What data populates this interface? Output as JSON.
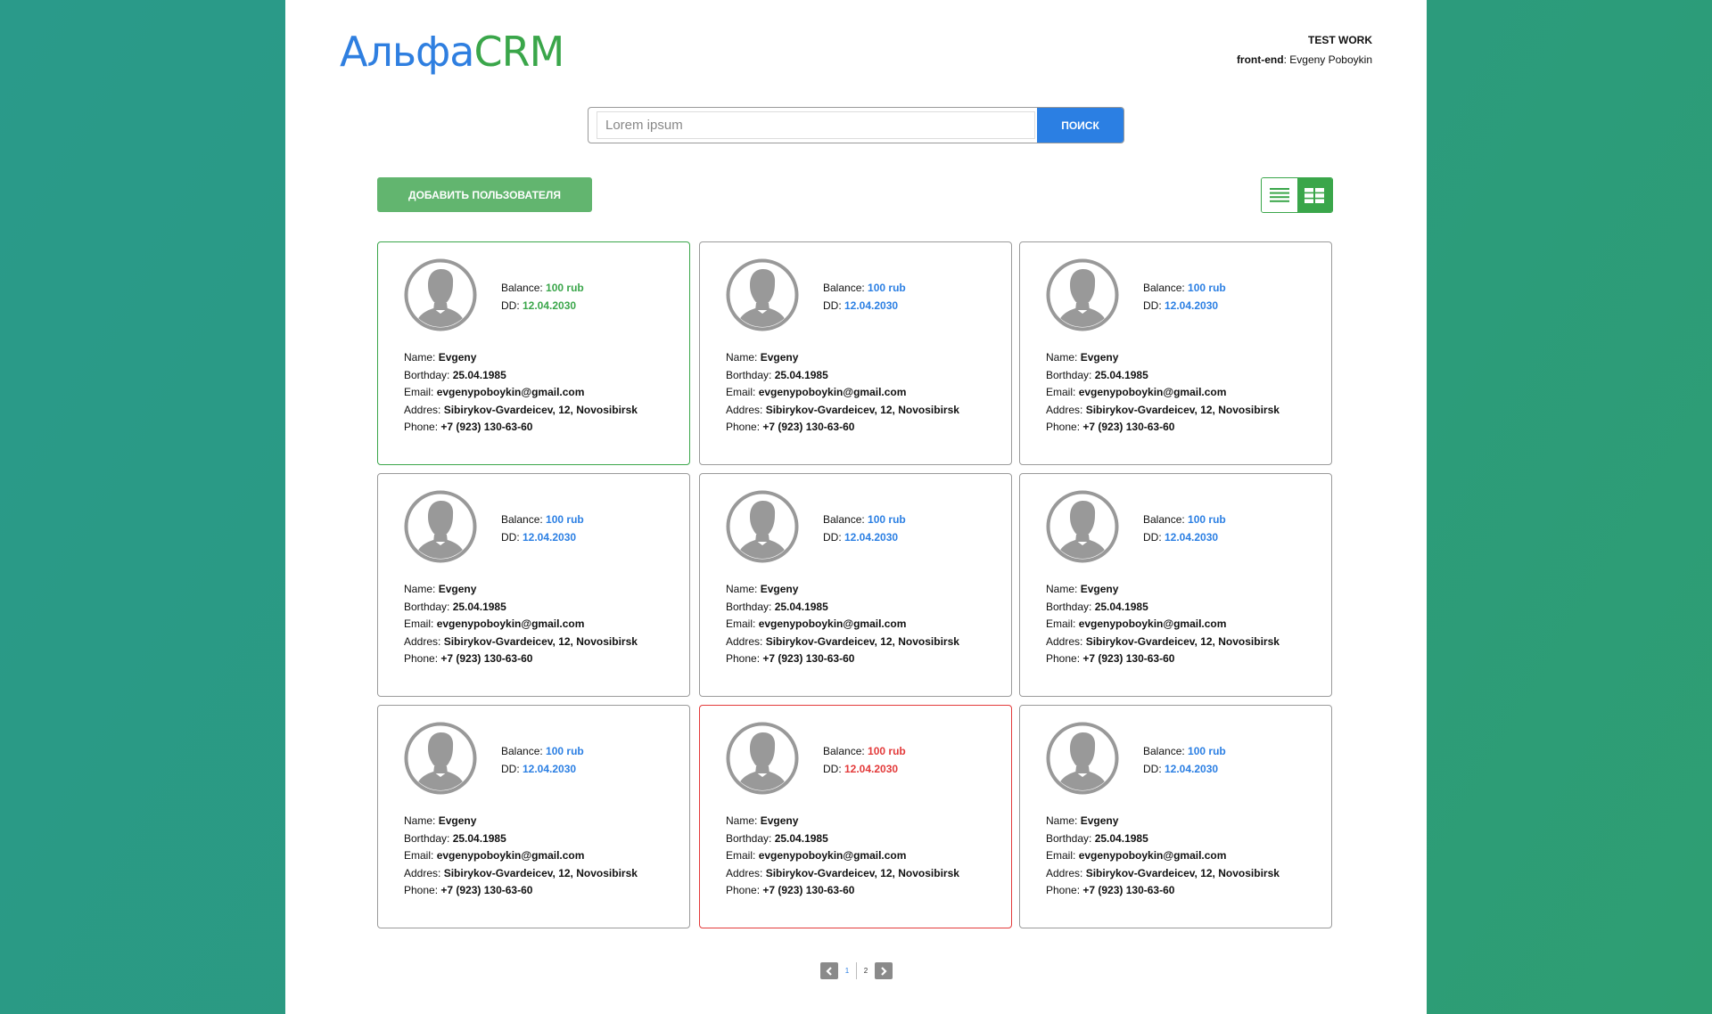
{
  "header": {
    "logo_part1": "Альфа",
    "logo_part2": "CRM",
    "title": "TEST WORK",
    "credit_label": "front-end",
    "credit_sep": ": ",
    "credit_name": "Evgeny Poboykin"
  },
  "search": {
    "placeholder": "Lorem ipsum",
    "button_label": "ПОИСК"
  },
  "toolbar": {
    "add_user_label": "ДОБАВИТЬ ПОЛЬЗОВАТЕЛЯ",
    "active_view": "grid"
  },
  "labels": {
    "balance": "Balance: ",
    "dd": "DD: ",
    "name": "Name: ",
    "birthday": "Borthday: ",
    "email": "Email: ",
    "address": "Addres: ",
    "phone": "Phone: "
  },
  "colors": {
    "brand_blue": "#2b7fe3",
    "brand_green": "#3aa64a",
    "alert_red": "#e33a3a"
  },
  "users": [
    {
      "balance": "100 rub",
      "dd": "12.04.2030",
      "name": "Evgeny",
      "birthday": "25.04.1985",
      "email": "evgenypoboykin@gmail.com",
      "address": "Sibirykov-Gvardeicev, 12, Novosibirsk",
      "phone": "+7 (923) 130-63-60",
      "status": "active"
    },
    {
      "balance": "100 rub",
      "dd": "12.04.2030",
      "name": "Evgeny",
      "birthday": "25.04.1985",
      "email": "evgenypoboykin@gmail.com",
      "address": "Sibirykov-Gvardeicev, 12, Novosibirsk",
      "phone": "+7 (923) 130-63-60",
      "status": "normal"
    },
    {
      "balance": "100 rub",
      "dd": "12.04.2030",
      "name": "Evgeny",
      "birthday": "25.04.1985",
      "email": "evgenypoboykin@gmail.com",
      "address": "Sibirykov-Gvardeicev, 12, Novosibirsk",
      "phone": "+7 (923) 130-63-60",
      "status": "normal"
    },
    {
      "balance": "100 rub",
      "dd": "12.04.2030",
      "name": "Evgeny",
      "birthday": "25.04.1985",
      "email": "evgenypoboykin@gmail.com",
      "address": "Sibirykov-Gvardeicev, 12, Novosibirsk",
      "phone": "+7 (923) 130-63-60",
      "status": "normal"
    },
    {
      "balance": "100 rub",
      "dd": "12.04.2030",
      "name": "Evgeny",
      "birthday": "25.04.1985",
      "email": "evgenypoboykin@gmail.com",
      "address": "Sibirykov-Gvardeicev, 12, Novosibirsk",
      "phone": "+7 (923) 130-63-60",
      "status": "normal"
    },
    {
      "balance": "100 rub",
      "dd": "12.04.2030",
      "name": "Evgeny",
      "birthday": "25.04.1985",
      "email": "evgenypoboykin@gmail.com",
      "address": "Sibirykov-Gvardeicev, 12, Novosibirsk",
      "phone": "+7 (923) 130-63-60",
      "status": "normal"
    },
    {
      "balance": "100 rub",
      "dd": "12.04.2030",
      "name": "Evgeny",
      "birthday": "25.04.1985",
      "email": "evgenypoboykin@gmail.com",
      "address": "Sibirykov-Gvardeicev, 12, Novosibirsk",
      "phone": "+7 (923) 130-63-60",
      "status": "normal"
    },
    {
      "balance": "100 rub",
      "dd": "12.04.2030",
      "name": "Evgeny",
      "birthday": "25.04.1985",
      "email": "evgenypoboykin@gmail.com",
      "address": "Sibirykov-Gvardeicev, 12, Novosibirsk",
      "phone": "+7 (923) 130-63-60",
      "status": "alert"
    },
    {
      "balance": "100 rub",
      "dd": "12.04.2030",
      "name": "Evgeny",
      "birthday": "25.04.1985",
      "email": "evgenypoboykin@gmail.com",
      "address": "Sibirykov-Gvardeicev, 12, Novosibirsk",
      "phone": "+7 (923) 130-63-60",
      "status": "normal"
    }
  ],
  "pagination": {
    "pages": [
      "1",
      "2"
    ],
    "current": "1",
    "prev_icon": "chevron-left-icon",
    "next_icon": "chevron-right-icon"
  }
}
